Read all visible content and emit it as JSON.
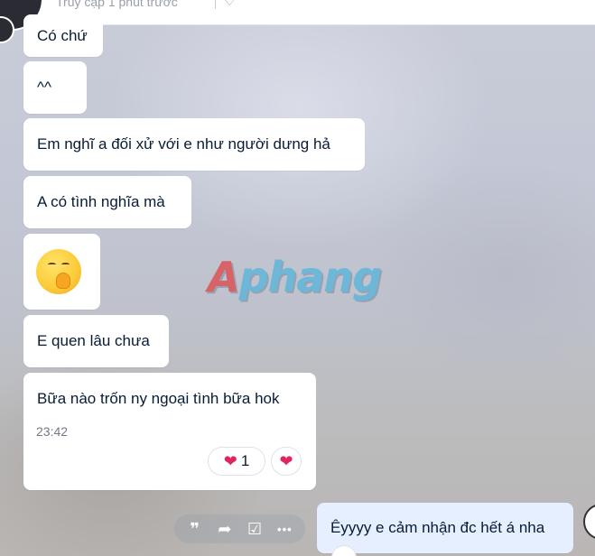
{
  "header": {
    "status_text": "Truy cập 1 phút trước",
    "tag_icon": "tag-icon"
  },
  "watermark": {
    "first": "A",
    "rest": "phang"
  },
  "messages": [
    {
      "text": "Có chứ"
    },
    {
      "text": "^^"
    },
    {
      "text": "Em nghĩ a đối xử với e như người dưng hả"
    },
    {
      "text": "A có tình nghĩa mà"
    },
    {
      "emoji": "hand-over-mouth-emoji"
    },
    {
      "text": "E quen lâu chưa"
    },
    {
      "text": "Bữa nào trốn ny ngoại tình bữa hok",
      "time": "23:42"
    }
  ],
  "reactions": {
    "heart_count": "1",
    "heart_glyph": "❤",
    "icon": "heart-icon"
  },
  "message_actions": [
    {
      "icon": "quote-icon",
      "glyph": "❞"
    },
    {
      "icon": "share-icon",
      "glyph": "➦"
    },
    {
      "icon": "task-icon",
      "glyph": "☑"
    },
    {
      "icon": "more-icon",
      "glyph": "•••"
    }
  ],
  "my_message": {
    "text": "Êyyyy e cảm nhận đc hết á nha"
  }
}
